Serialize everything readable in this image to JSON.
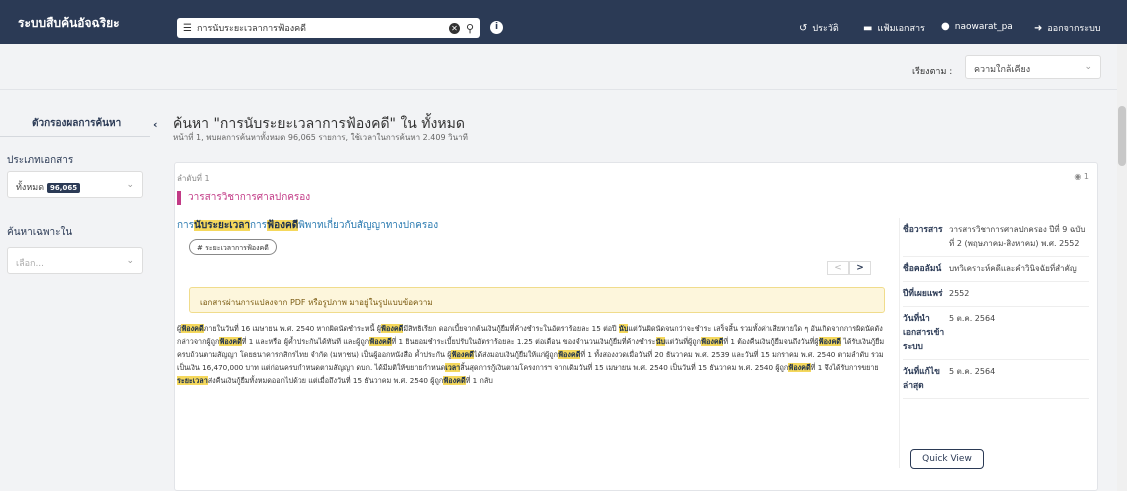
{
  "app": {
    "title": "ระบบสืบค้นอัจฉริยะ",
    "brand_color": "#2b3a55"
  },
  "search": {
    "query": "การนับระยะเวลาการฟ้องคดี",
    "icons": [
      "menu-icon",
      "clear-icon",
      "search-icon",
      "info-icon"
    ]
  },
  "topnav": {
    "history": "ประวัติ",
    "folders": "แฟ้มเอกสาร",
    "user": "naowarat_pa",
    "logout": "ออกจากระบบ"
  },
  "sort": {
    "label": "เรียงตาม :",
    "value": "ความใกล้เคียง"
  },
  "sidebar": {
    "title": "ตัวกรองผลการค้นหา",
    "doc_type_label": "ประเภทเอกสาร",
    "doc_type_value": "ทั้งหมด",
    "doc_type_count": "96,065",
    "specific_label": "ค้นหาเฉพาะใน",
    "specific_placeholder": "เลือก..."
  },
  "main": {
    "title": "ค้นหา \"การนับระยะเวลาการฟ้องคดี\" ใน ทั้งหมด",
    "subtitle": "หน้าที่ 1, พบผลการค้นหาทั้งหมด 96,065 รายการ, ใช้เวลาในการค้นหา 2.409 วินาที"
  },
  "result": {
    "rank": "ลำดับที่ 1",
    "views": "1",
    "category": "วารสารวิชาการศาลปกครอง",
    "category_color": "#c23a86",
    "title_parts": [
      "การ",
      "นับระยะเวลา",
      "การ",
      "ฟ้องคดี",
      "พิพาทเกี่ยวกับสัญญาทางปกครอง"
    ],
    "tag": "# ระยะเวลาการฟ้องคดี",
    "pager_prev": "<",
    "pager_next": ">",
    "notice": "เอกสารผ่านการแปลงจาก PDF หรือรูปภาพ มาอยู่ในรูปแบบข้อความ",
    "snippet_parts": [
      "ผู้",
      "ฟ้องคดี",
      "ภายในวันที่ 16 เมษายน พ.ศ. 2540 หากผิดนัดชำระหนี้ ผู้",
      "ฟ้องคดี",
      "มีสิทธิเรียก ดอกเบี้ยจากต้นเงินกู้ยืมที่ค้างชำระในอัตราร้อยละ 15 ต่อปี ",
      "นับ",
      "แต่วันผิดนัดจนกว่าจะชำระ เสร็จสิ้น รวมทั้งค่าเสียหายใด ๆ อันเกิดจากการผิดนัดดังกล่าวจากผู้ถูก",
      "ฟ้องคดี",
      "ที่ 1 และหรือ ผู้ค้ำประกันได้ทันที และผู้ถูก",
      "ฟ้องคดี",
      "ที่ 1 ยินยอมชำระเบี้ยปรับในอัตราร้อยละ 1.25 ต่อเดือน ของจำนวนเงินกู้ยืมที่ค้างชำระ",
      "นับ",
      "แต่วันที่ผู้ถูก",
      "ฟ้องคดี",
      "ที่ 1 ต้องคืนเงินกู้ยืมจนถึงวันที่ผู้",
      "ฟ้องคดี",
      " ได้รับเงินกู้ยืมครบถ้วนตามสัญญา โดยธนาคารกสิกรไทย จำกัด (มหาชน) เป็นผู้ออกหนังสือ ค้ำประกัน ผู้",
      "ฟ้องคดี",
      "ได้ส่งมอบเงินกู้ยืมให้แก่ผู้ถูก",
      "ฟ้องคดี",
      "ที่ 1 ทั้งสองงวดเมื่อวันที่ 20 ธันวาคม พ.ศ. 2539 และวันที่ 15 มกราคม พ.ศ. 2540 ตามลำดับ รวมเป็นเงิน 16,470,000 บาท แต่ก่อนครบกำหนดตามสัญญา ดบก. ได้มีมติให้ขยายกำหนด",
      "เวลา",
      "สิ้นสุดการกู้เงินตามโครงการฯ จากเดิมวันที่ 15 เมษายน พ.ศ. 2540 เป็นวันที่ 15 ธันวาคม พ.ศ. 2540 ผู้ถูก",
      "ฟ้องคดี",
      "ที่ 1 จึงได้รับการขยาย",
      "ระยะเวลา",
      "ส่งคืนเงินกู้ยืมทั้งหมดออกไปด้วย แต่เมื่อถึงวันที่ 15 ธันวาคม พ.ศ. 2540 ผู้ถูก",
      "ฟ้องคดี",
      "ที่ 1 กลับ"
    ],
    "meta": [
      {
        "k": "ชื่อวารสาร",
        "v": "วารสารวิชาการศาลปกครอง ปีที่ 9 ฉบับที่ 2 (พฤษภาคม-สิงหาคม) พ.ศ. 2552"
      },
      {
        "k": "ชื่อคอลัมน์",
        "v": "บทวิเคราะห์คดีและคำวินิจฉัยที่สำคัญ"
      },
      {
        "k": "ปีที่เผยแพร่",
        "v": "2552"
      },
      {
        "k": "วันที่นำเอกสารเข้าระบบ",
        "v": "5 ต.ค. 2564"
      },
      {
        "k": "วันที่แก้ไขล่าสุด",
        "v": "5 ต.ค. 2564"
      }
    ],
    "quick_view": "Quick View"
  }
}
